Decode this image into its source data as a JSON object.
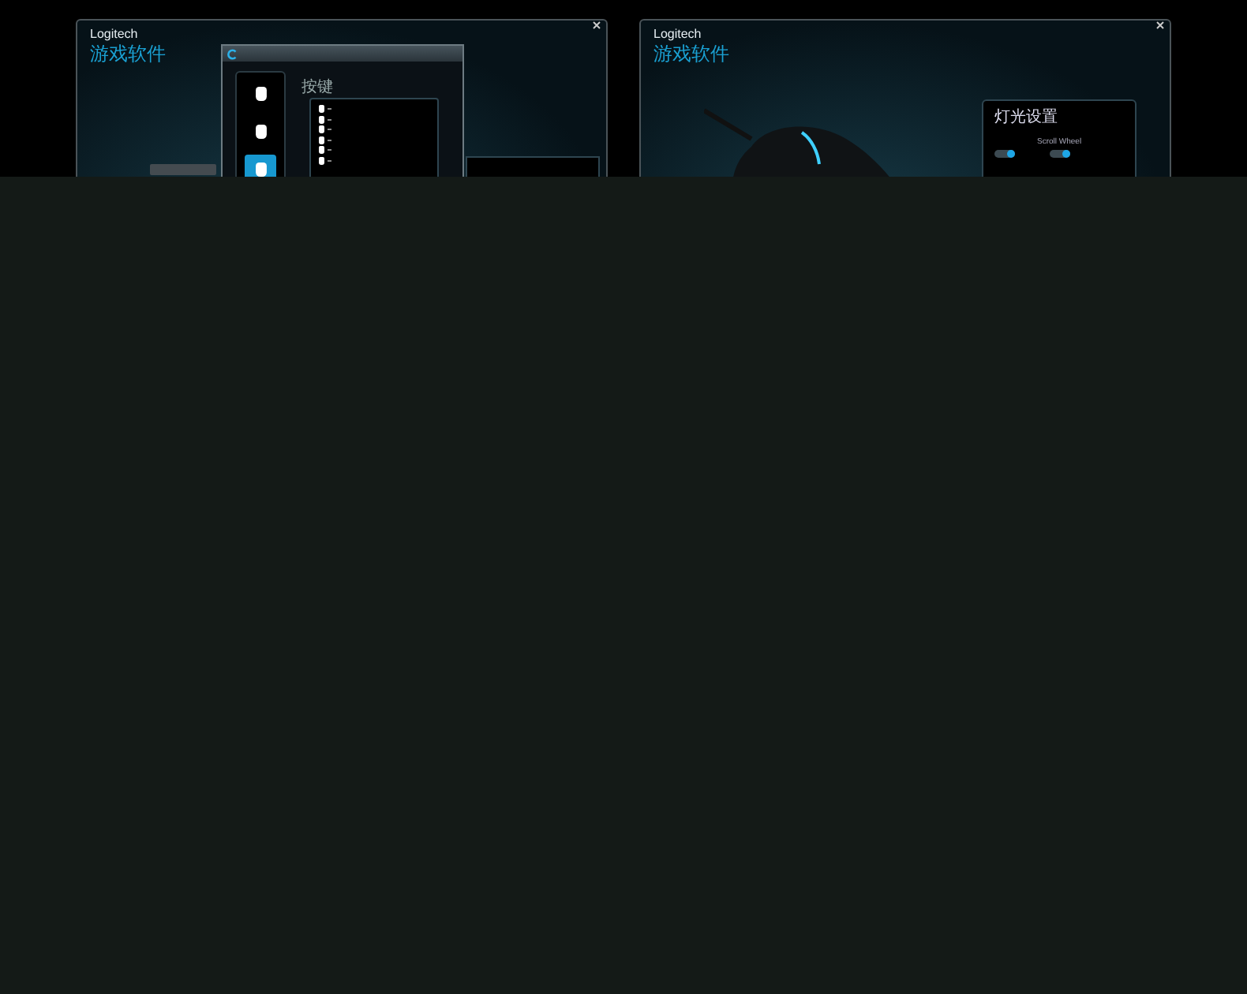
{
  "windows": [
    {
      "kind": "buttons",
      "brand": "Logitech",
      "title": "游戏软件",
      "dialog": {
        "section_label": "按键",
        "sidebar": [
          {
            "selected": false
          },
          {
            "selected": false
          },
          {
            "selected": true
          }
        ]
      }
    },
    {
      "kind": "lighting",
      "brand": "Logitech",
      "title": "游戏软件",
      "panel": {
        "title": "灯光设置",
        "toggles": [
          {
            "on": true
          },
          {
            "label": "Scroll Wheel",
            "on": true
          }
        ]
      }
    }
  ]
}
